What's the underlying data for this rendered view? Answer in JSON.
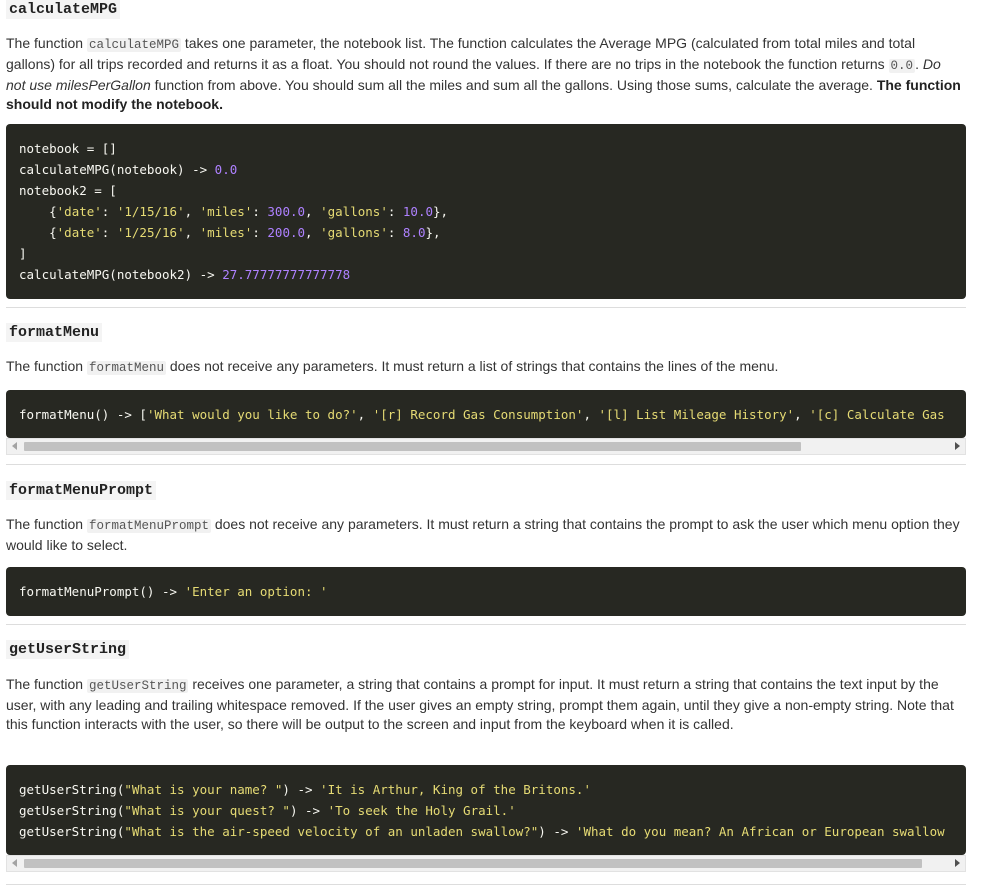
{
  "sections": {
    "calculate_mpg": {
      "heading": "calculateMPG",
      "para": {
        "p1": "The function ",
        "code1": "calculateMPG",
        "p2": " takes one parameter, the notebook list. The function calculates the Average MPG (calculated from total miles and total gallons) for all trips recorded and returns it as a float. You should not round the values. If there are no trips in the notebook the function returns ",
        "code2": "0.0",
        "p3": ". ",
        "em": "Do not use milesPerGallon",
        "p4": " function from above. You should sum all the miles and sum all the gallons. Using those sums, calculate the average. ",
        "strong": "The function should not modify the notebook."
      },
      "code": {
        "l1": "notebook = []",
        "l2a": "calculateMPG(notebook) -> ",
        "l2n": "0.0",
        "l3": "notebook2 = [",
        "l4a": "    {",
        "l4s1": "'date'",
        "l4b": ": ",
        "l4s2": "'1/15/16'",
        "l4c": ", ",
        "l4s3": "'miles'",
        "l4d": ": ",
        "l4n1": "300.0",
        "l4e": ", ",
        "l4s4": "'gallons'",
        "l4f": ": ",
        "l4n2": "10.0",
        "l4g": "},",
        "l5a": "    {",
        "l5s1": "'date'",
        "l5b": ": ",
        "l5s2": "'1/25/16'",
        "l5c": ", ",
        "l5s3": "'miles'",
        "l5d": ": ",
        "l5n1": "200.0",
        "l5e": ", ",
        "l5s4": "'gallons'",
        "l5f": ": ",
        "l5n2": "8.0",
        "l5g": "},",
        "l6": "]",
        "l7a": "calculateMPG(notebook2) -> ",
        "l7n": "27.77777777777778"
      }
    },
    "format_menu": {
      "heading": "formatMenu",
      "para": {
        "p1": "The function ",
        "code1": "formatMenu",
        "p2": " does not receive any parameters. It must return a list of strings that contains the lines of the menu."
      },
      "code": {
        "a": "formatMenu() -> [",
        "s1": "'What would you like to do?'",
        "b": ", ",
        "s2": "'[r] Record Gas Consumption'",
        "c": ", ",
        "s3": "'[l] List Mileage History'",
        "d": ", ",
        "s4": "'[c] Calculate Gas"
      }
    },
    "format_menu_prompt": {
      "heading": "formatMenuPrompt",
      "para": {
        "p1": "The function ",
        "code1": "formatMenuPrompt",
        "p2": " does not receive any parameters. It must return a string that contains the prompt to ask the user which menu option they would like to select."
      },
      "code": {
        "a": "formatMenuPrompt() -> ",
        "s1": "'Enter an option: '"
      }
    },
    "get_user_string": {
      "heading": "getUserString",
      "para": {
        "p1": "The function ",
        "code1": "getUserString",
        "p2": " receives one parameter, a string that contains a prompt for input. It must return a string that contains the text input by the user, with any leading and trailing whitespace removed. If the user gives an empty string, prompt them again, until they give a non-empty string. Note that this function interacts with the user, so there will be output to the screen and input from the keyboard when it is called."
      },
      "code": {
        "l1a": "getUserString(",
        "l1s1": "\"What is your name? \"",
        "l1b": ") -> ",
        "l1s2": "'It is Arthur, King of the Britons.'",
        "l2a": "getUserString(",
        "l2s1": "\"What is your quest? \"",
        "l2b": ") -> ",
        "l2s2": "'To seek the Holy Grail.'",
        "l3a": "getUserString(",
        "l3s1": "\"What is the air-speed velocity of an unladen swallow?\"",
        "l3b": ") -> ",
        "l3s2": "'What do you mean? An African or European swallow"
      }
    }
  },
  "colors": {
    "code_bg": "#272822",
    "code_text": "#f8f8f2",
    "code_string": "#e6db74",
    "code_number": "#ae81ff"
  }
}
